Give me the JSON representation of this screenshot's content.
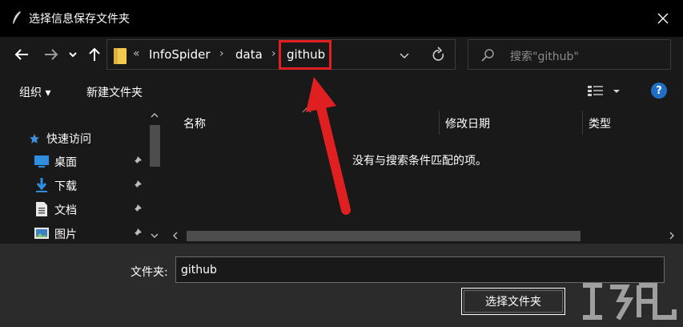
{
  "window": {
    "title": "选择信息保存文件夹"
  },
  "nav": {
    "breadcrumbs": [
      "InfoSpider",
      "data",
      "github"
    ],
    "overflow_chevron": "«",
    "separator": "›",
    "search_placeholder": "搜索\"github\""
  },
  "toolbar": {
    "organize_label": "组织 ▾",
    "new_folder_label": "新建文件夹",
    "help_label": "?"
  },
  "sidebar": {
    "items": [
      {
        "label": "快速访问",
        "icon": "star-icon"
      },
      {
        "label": "桌面",
        "icon": "desktop-icon",
        "pinned": true
      },
      {
        "label": "下载",
        "icon": "download-icon",
        "pinned": true
      },
      {
        "label": "文档",
        "icon": "document-icon",
        "pinned": true
      },
      {
        "label": "图片",
        "icon": "pictures-icon",
        "pinned": true
      }
    ]
  },
  "file_list": {
    "columns": [
      "名称",
      "修改日期",
      "类型"
    ],
    "empty_message": "没有与搜索条件匹配的项。"
  },
  "footer": {
    "folder_label": "文件夹:",
    "folder_value": "github",
    "select_button": "选择文件夹"
  },
  "colors": {
    "highlight": "#e02020",
    "accent_blue": "#1f6fc5",
    "folder_yellow": "#f2c94c"
  }
}
